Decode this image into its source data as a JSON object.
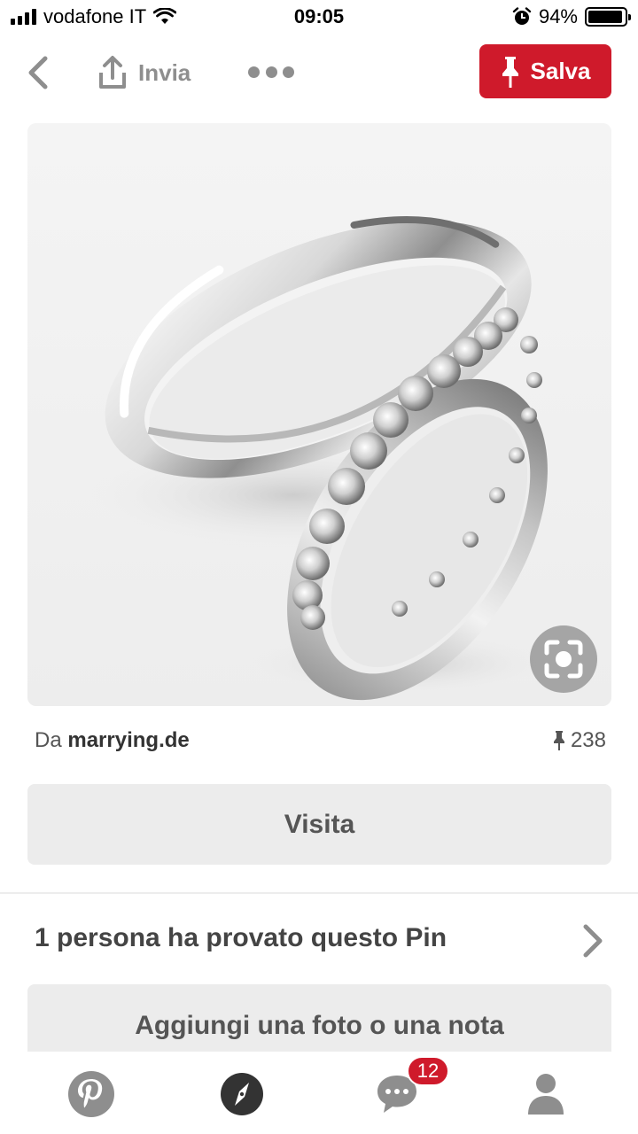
{
  "status_bar": {
    "carrier": "vodafone IT",
    "time": "09:05",
    "battery": "94%",
    "battery_level": 0.94
  },
  "topbar": {
    "share_label": "Invia",
    "save_label": "Salva"
  },
  "pin": {
    "source_prefix": "Da",
    "source_domain": "marrying.de",
    "save_count": "238"
  },
  "actions": {
    "visit_label": "Visita",
    "tried_text": "1 persona ha provato questo Pin",
    "add_label": "Aggiungi una foto o una nota"
  },
  "tabbar": {
    "messages_badge": "12"
  },
  "colors": {
    "brand_red": "#cf1a2b",
    "tab_gray": "#8e8e8e",
    "tab_active": "#333333"
  }
}
